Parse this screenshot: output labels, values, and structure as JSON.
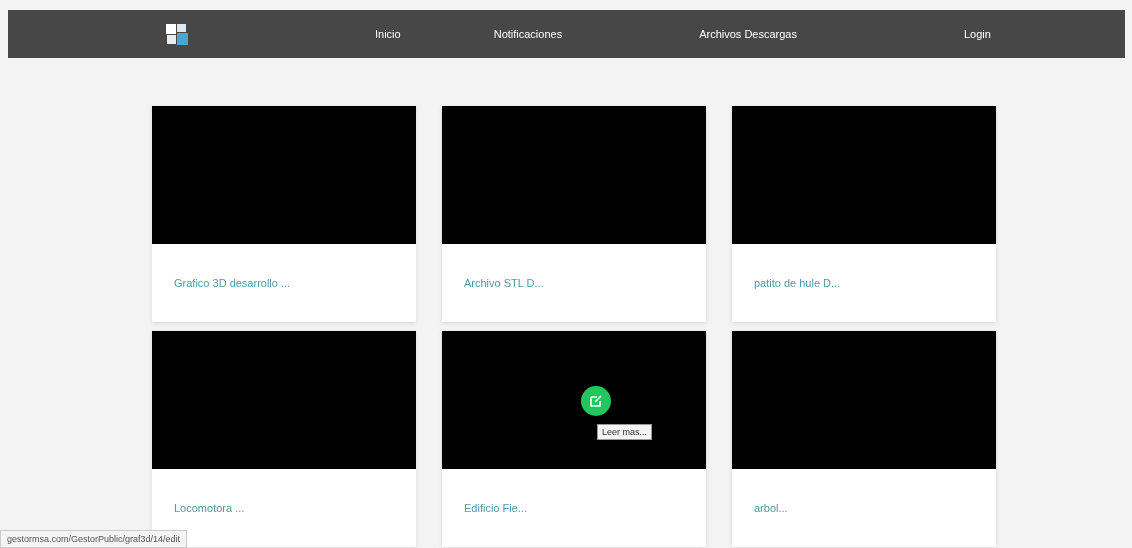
{
  "nav": {
    "items": [
      "Inicio",
      "Notificaciones",
      "Archivos Descargas",
      "Login"
    ]
  },
  "cards": [
    {
      "title": "Grafico 3D desarrollo ..."
    },
    {
      "title": "Archivo STL D..."
    },
    {
      "title": "patito de hule D..."
    },
    {
      "title": "Locomotora ..."
    },
    {
      "title": "Edificio Fie...",
      "hover_tooltip": "Leer mas..."
    },
    {
      "title": "arbol..."
    }
  ],
  "status_bar": {
    "url": "gestormsa.com/GestorPublic/graf3d/14/edit"
  }
}
